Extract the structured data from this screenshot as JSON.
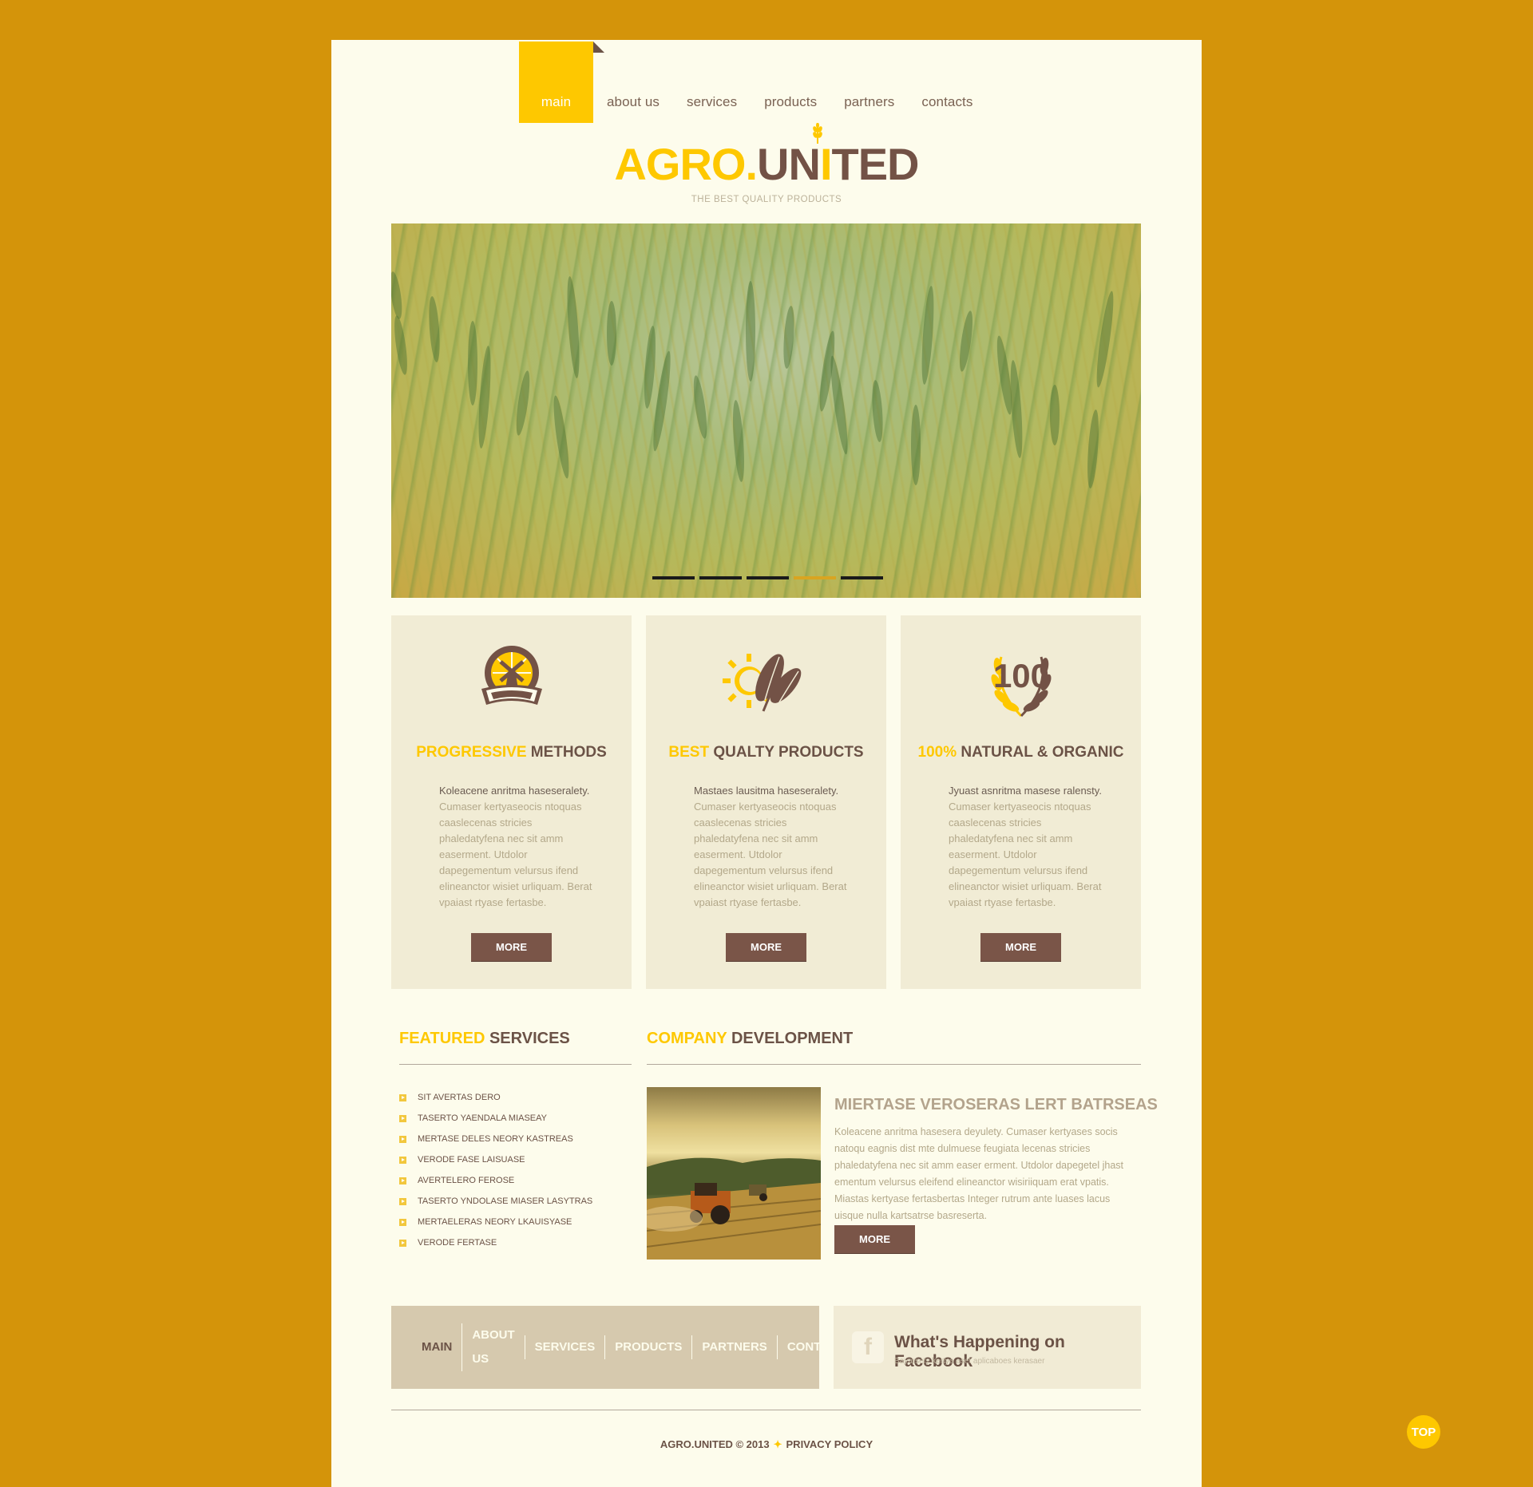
{
  "nav": {
    "items": [
      {
        "label": "main"
      },
      {
        "label": "about us"
      },
      {
        "label": "services"
      },
      {
        "label": "products"
      },
      {
        "label": "partners"
      },
      {
        "label": "contacts"
      }
    ],
    "active_index": 0
  },
  "logo": {
    "part1": "AGRO.",
    "part2": "UN",
    "part3": "I",
    "part4": "TED",
    "tagline": "THE BEST QUALITY PRODUCTS"
  },
  "slider": {
    "slide_count": 5,
    "active_index": 3
  },
  "features": [
    {
      "title_highlight": "PROGRESSIVE",
      "title_rest": "METHODS",
      "icon": "windmill-icon",
      "lead": "Koleacene anritma haseseralety.",
      "body": "Cumaser kertyaseocis ntoquas caaslecenas stricies phaledatyfena nec sit amm easerment. Utdolor dapegementum velursus ifend elineanctor wisiet urliquam. Berat vpaiast rtyase fertasbe.",
      "button": "MORE"
    },
    {
      "title_highlight": "BEST",
      "title_rest": "QUALTY PRODUCTS",
      "icon": "wheat-sun-icon",
      "lead": "Mastaes lausitma haseseralety.",
      "body": "Cumaser kertyaseocis ntoquas caaslecenas stricies phaledatyfena nec sit amm easerment. Utdolor dapegementum velursus ifend elineanctor wisiet urliquam. Berat vpaiast rtyase fertasbe.",
      "button": "MORE"
    },
    {
      "title_highlight": "100%",
      "title_rest": "NATURAL & ORGANIC",
      "icon": "laurel-100-icon",
      "badge": "100",
      "lead": "Jyuast asnritma masese ralensty.",
      "body": "Cumaser kertyaseocis ntoquas caaslecenas stricies phaledatyfena nec sit amm easerment. Utdolor dapegementum velursus ifend elineanctor wisiet urliquam. Berat vpaiast rtyase fertasbe.",
      "button": "MORE"
    }
  ],
  "featured_services": {
    "title_highlight": "FEATURED",
    "title_rest": "SERVICES",
    "items": [
      "SIT AVERTAS DERO",
      "TASERTO YAENDALA MIASEAY",
      "MERTASE DELES NEORY KASTREAS",
      "VERODE FASE LAISUASE",
      "AVERTELERO FEROSE",
      "TASERTO YNDOLASE MIASER LASYTRAS",
      "MERTAELERAS NEORY LKAUISYASE",
      "VERODE FERTASE"
    ]
  },
  "company_development": {
    "title_highlight": "COMPANY",
    "title_rest": "DEVELOPMENT",
    "article_title": "MIERTASE VEROSERAS LERT BATRSEAS",
    "article_text": "Koleacene anritma hasesera deyulety. Cumaser kertyases socis natoqu eagnis dist mte dulmuese feugiata lecenas stricies phaledatyfena nec sit amm easer erment. Utdolor dapegetel jhast ementum velursus eleifend elineanctor wisiriiquam erat vpatis. Miastas kertyase fertasbertas Integer rutrum ante luases lacus uisque nulla kartsatrse basreserta.",
    "button": "MORE"
  },
  "footer": {
    "links": [
      "MAIN",
      "ABOUT US",
      "SERVICES",
      "PRODUCTS",
      "PARTNERS",
      "CONTACTS"
    ],
    "facebook_title": "What's Happening on Facebook",
    "facebook_sub": "Bayarsety kertya aset aplicaboes kerasaer",
    "copyright": "AGRO.UNITED © 2013",
    "privacy": "PRIVACY POLICY"
  },
  "top_button": "TOP",
  "colors": {
    "background": "#d4940a",
    "page": "#fdfcec",
    "accent": "#fec800",
    "brown": "#6b5246",
    "button": "#7a5548"
  }
}
